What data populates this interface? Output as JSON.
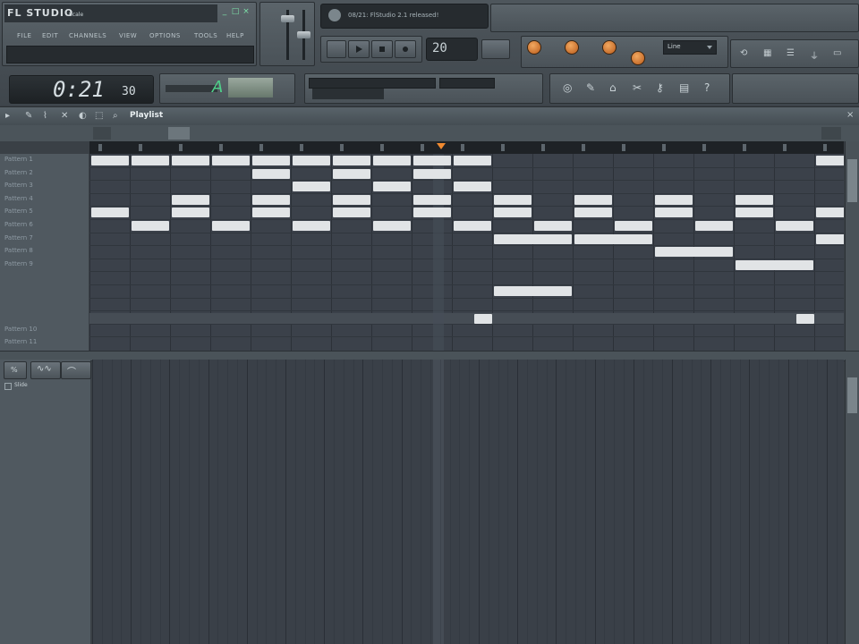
{
  "app": {
    "logo": "FL STUDIO",
    "subtitle": "Scale",
    "window_buttons": [
      "_",
      "□",
      "×"
    ]
  },
  "menu": [
    "FILE",
    "EDIT",
    "CHANNELS",
    "VIEW",
    "OPTIONS",
    "TOOLS",
    "HELP"
  ],
  "hint_text": "08/21: FlStudio 2.1 released!",
  "time": {
    "main": "0:21",
    "sub": "30"
  },
  "pattern_num": "20",
  "snap": "Line",
  "playlist": {
    "title": "Playlist",
    "tracks": [
      "Pattern 1",
      "Pattern 2",
      "Pattern 3",
      "Pattern 4",
      "Pattern 5",
      "Pattern 6",
      "Pattern 7",
      "Pattern 8",
      "Pattern 9",
      "",
      "",
      "",
      "",
      "Pattern 10",
      "Pattern 11"
    ]
  },
  "lower": {
    "tabs": [
      "%"
    ],
    "label": "Slide"
  },
  "colors": {
    "clip": "#e1e4e6",
    "accent": "#f08a30",
    "grid": "#3b414a"
  }
}
